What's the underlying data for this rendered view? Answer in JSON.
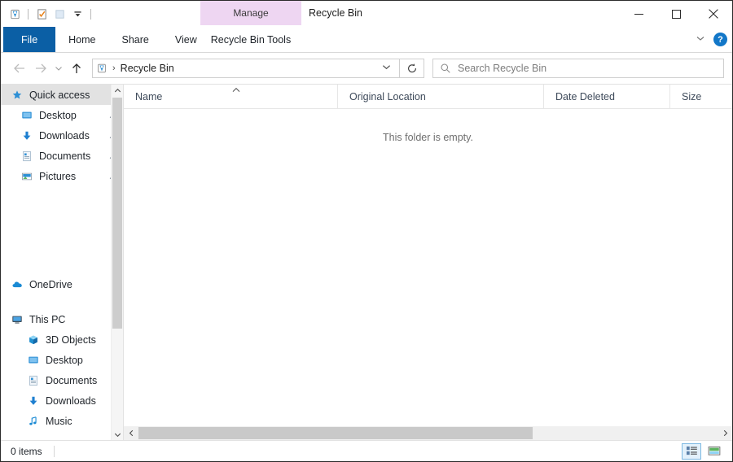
{
  "window": {
    "title": "Recycle Bin",
    "controls": {
      "minimize": "minimize-button",
      "maximize": "maximize-button",
      "close": "close-button"
    }
  },
  "quick_access_toolbar": {
    "items": [
      {
        "name": "recycle-bin-icon",
        "label": "Recycle Bin"
      },
      {
        "name": "properties-icon",
        "label": "Properties"
      },
      {
        "name": "new-folder-icon",
        "label": "New folder"
      },
      {
        "name": "customize-dropdown-icon",
        "label": "Customize Quick Access Toolbar"
      }
    ]
  },
  "ribbon": {
    "contextual_header": "Manage",
    "tabs": [
      {
        "label": "File",
        "active": true
      },
      {
        "label": "Home",
        "active": false
      },
      {
        "label": "Share",
        "active": false
      },
      {
        "label": "View",
        "active": false
      },
      {
        "label": "Recycle Bin Tools",
        "active": false
      }
    ],
    "collapse_label": "Minimize the Ribbon",
    "help_label": "?"
  },
  "navigation": {
    "back_label": "Back",
    "forward_label": "Forward",
    "recent_label": "Recent locations",
    "up_label": "Up",
    "refresh_label": "Refresh"
  },
  "address": {
    "icon": "recycle-bin-icon",
    "separator": "›",
    "path": "Recycle Bin",
    "dropdown": "Previous locations"
  },
  "search": {
    "placeholder": "Search Recycle Bin",
    "value": ""
  },
  "sidebar": {
    "groups": [
      {
        "name": "quick-access",
        "header": {
          "label": "Quick access",
          "icon": "star-icon",
          "selected": true
        },
        "items": [
          {
            "label": "Desktop",
            "icon": "desktop-icon",
            "pinned": true
          },
          {
            "label": "Downloads",
            "icon": "download-icon",
            "pinned": true
          },
          {
            "label": "Documents",
            "icon": "documents-icon",
            "pinned": true
          },
          {
            "label": "Pictures",
            "icon": "pictures-icon",
            "pinned": true
          }
        ]
      },
      {
        "name": "onedrive",
        "header": {
          "label": "OneDrive",
          "icon": "cloud-icon",
          "selected": false
        },
        "items": []
      },
      {
        "name": "this-pc",
        "header": {
          "label": "This PC",
          "icon": "monitor-icon",
          "selected": false
        },
        "items": [
          {
            "label": "3D Objects",
            "icon": "3d-objects-icon",
            "pinned": false
          },
          {
            "label": "Desktop",
            "icon": "desktop-icon",
            "pinned": false
          },
          {
            "label": "Documents",
            "icon": "documents-icon",
            "pinned": false
          },
          {
            "label": "Downloads",
            "icon": "download-icon",
            "pinned": false
          },
          {
            "label": "Music",
            "icon": "music-icon",
            "pinned": false
          }
        ]
      }
    ]
  },
  "file_list": {
    "columns": [
      {
        "label": "Name",
        "sorted": "asc"
      },
      {
        "label": "Original Location",
        "sorted": ""
      },
      {
        "label": "Date Deleted",
        "sorted": ""
      },
      {
        "label": "Size",
        "sorted": ""
      }
    ],
    "rows": [],
    "empty_message": "This folder is empty."
  },
  "status_bar": {
    "item_count": "0 items",
    "views": [
      {
        "name": "details-view-button",
        "label": "Details view",
        "active": true
      },
      {
        "name": "large-icons-view-button",
        "label": "Large icons view",
        "active": false
      }
    ]
  },
  "colors": {
    "file_tab_blue": "#0b5fa5",
    "contextual_purple": "#eed6f2",
    "selection_grey": "#e2e2e2",
    "accent_blue": "#1277c8"
  }
}
